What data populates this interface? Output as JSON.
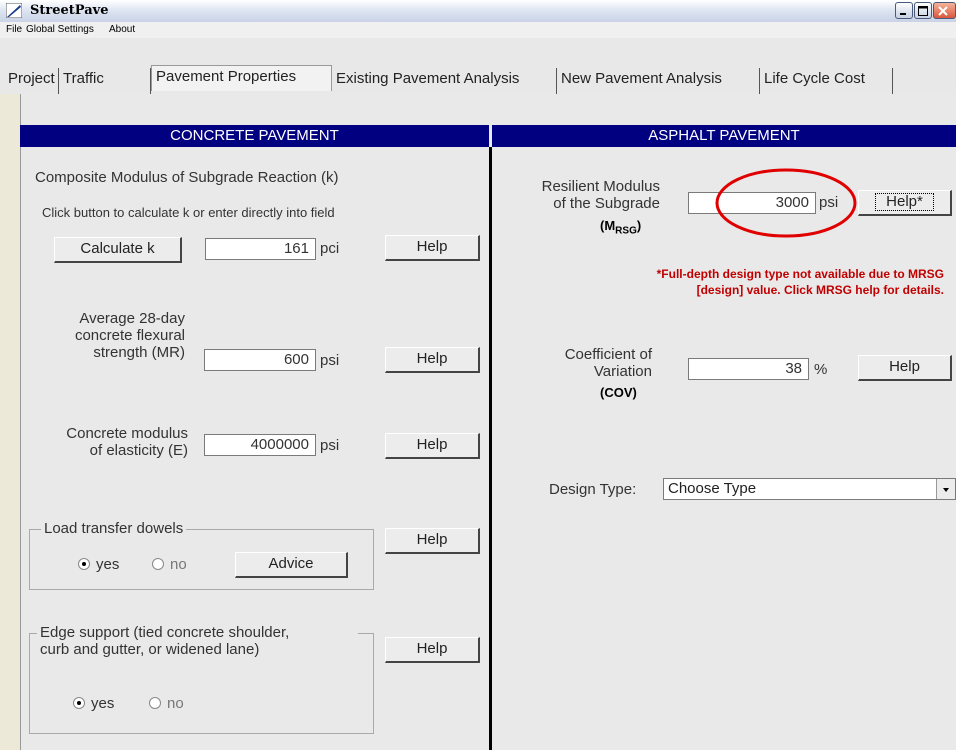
{
  "window": {
    "title": "StreetPave"
  },
  "menu": [
    "File",
    "Global Settings",
    "About"
  ],
  "tabs": [
    "Project",
    "Traffic",
    "Pavement Properties",
    "Existing Pavement Analysis",
    "New Pavement Analysis",
    "Life Cycle Cost"
  ],
  "concrete": {
    "header": "CONCRETE PAVEMENT",
    "k_title": "Composite Modulus of Subgrade Reaction (k)",
    "k_hint": "Click button to calculate k or enter directly into field",
    "calc_k_label": "Calculate k",
    "k_value": "161",
    "k_unit": "pci",
    "mr_label_1": "Average 28-day",
    "mr_label_2": "concrete flexural",
    "mr_label_3": "strength (MR)",
    "mr_value": "600",
    "mr_unit": "psi",
    "e_label_1": "Concrete modulus",
    "e_label_2": "of elasticity (E)",
    "e_value": "4000000",
    "e_unit": "psi",
    "dowels_legend": "Load transfer dowels",
    "yes": "yes",
    "no": "no",
    "advice_label": "Advice",
    "edge_legend_1": "Edge support (tied concrete shoulder,",
    "edge_legend_2": "curb and gutter, or widened lane)",
    "help_label": "Help"
  },
  "asphalt": {
    "header": "ASPHALT PAVEMENT",
    "mrsg_label_1": "Resilient Modulus",
    "mrsg_label_2": "of the Subgrade",
    "mrsg_symbol": "(M",
    "mrsg_sub": "RSG",
    "mrsg_close": ")",
    "mrsg_value": "3000",
    "mrsg_unit": "psi",
    "help_star_label": "Help*",
    "warning_1": "*Full-depth design type not available due to MRSG",
    "warning_2": "[design] value. Click MRSG help for details.",
    "cov_label_1": "Coefficient of",
    "cov_label_2": "Variation",
    "cov_abbr": "(COV)",
    "cov_value": "38",
    "cov_unit": "%",
    "help_label": "Help",
    "design_type_label": "Design Type:",
    "design_type_value": "Choose Type"
  },
  "colors": {
    "header_bg": "#000080",
    "warning": "#c00000",
    "annotation": "#e00000"
  }
}
